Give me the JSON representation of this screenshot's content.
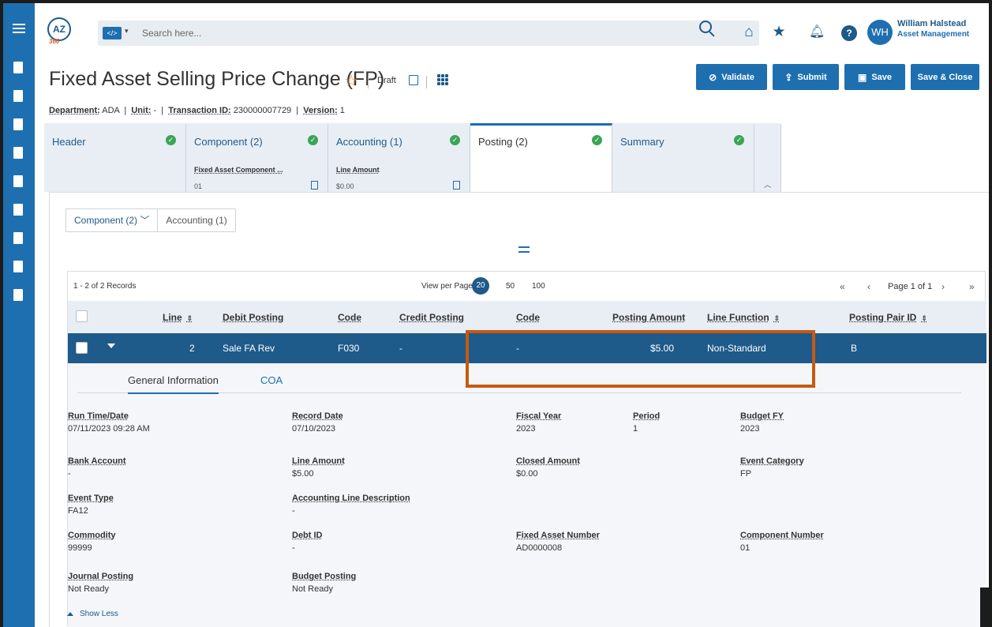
{
  "user": {
    "initials": "WH",
    "name": "William Halstead",
    "role": "Asset Management"
  },
  "logo": {
    "text": "AZ",
    "sub": "360"
  },
  "search": {
    "placeholder": "Search here...",
    "scope_icon": "code-icon"
  },
  "page": {
    "title": "Fixed Asset Selling Price Change (FP)",
    "status": "Draft",
    "department_label": "Department:",
    "department": "ADA",
    "unit_label": "Unit:",
    "unit": "-",
    "transaction_label": "Transaction ID:",
    "transaction_id": "230000007729",
    "version_label": "Version:",
    "version": "1"
  },
  "actions": {
    "validate": "Validate",
    "submit": "Submit",
    "save": "Save",
    "save_close": "Save & Close"
  },
  "tabs": [
    {
      "label": "Header"
    },
    {
      "label": "Component (2)",
      "sub_label": "Fixed Asset Component ...",
      "sub_value": "01"
    },
    {
      "label": "Accounting (1)",
      "sub_label": "Line Amount",
      "sub_value": "$0.00"
    },
    {
      "label": "Posting (2)"
    },
    {
      "label": "Summary"
    }
  ],
  "breadcrumb": [
    "Component (2)",
    "Accounting (1)"
  ],
  "grid": {
    "records": "1 - 2 of 2 Records",
    "view_per_page": "View per Page -",
    "page_sizes": [
      "20",
      "50",
      "100"
    ],
    "page_info": "Page 1 of 1",
    "columns": [
      "Line",
      "Debit Posting",
      "Code",
      "Credit Posting",
      "Code",
      "Posting Amount",
      "Line Function",
      "Posting Pair ID"
    ],
    "row": {
      "line": "2",
      "debit_posting": "Sale FA Rev",
      "debit_code": "F030",
      "credit_posting": "-",
      "credit_code": "-",
      "posting_amount": "$5.00",
      "line_function": "Non-Standard",
      "posting_pair_id": "B"
    }
  },
  "detail": {
    "tabs": [
      "General Information",
      "COA"
    ],
    "fields": {
      "run_time": {
        "label": "Run Time/Date",
        "value": "07/11/2023 09:28 AM"
      },
      "record_date": {
        "label": "Record Date",
        "value": "07/10/2023"
      },
      "fiscal_year": {
        "label": "Fiscal Year",
        "value": "2023"
      },
      "period": {
        "label": "Period",
        "value": "1"
      },
      "budget_fy": {
        "label": "Budget FY",
        "value": "2023"
      },
      "bank_account": {
        "label": "Bank Account",
        "value": "-"
      },
      "line_amount": {
        "label": "Line Amount",
        "value": "$5.00"
      },
      "closed_amount": {
        "label": "Closed Amount",
        "value": "$0.00"
      },
      "event_category": {
        "label": "Event Category",
        "value": "FP"
      },
      "event_type": {
        "label": "Event Type",
        "value": "FA12"
      },
      "acct_line_desc": {
        "label": "Accounting Line Description",
        "value": "-"
      },
      "commodity": {
        "label": "Commodity",
        "value": "99999"
      },
      "debt_id": {
        "label": "Debt ID",
        "value": "-"
      },
      "fixed_asset_number": {
        "label": "Fixed Asset Number",
        "value": "AD0000008"
      },
      "component_number": {
        "label": "Component Number",
        "value": "01"
      },
      "journal_posting": {
        "label": "Journal Posting",
        "value": "Not Ready"
      },
      "budget_posting": {
        "label": "Budget Posting",
        "value": "Not Ready"
      }
    },
    "show_less": "Show Less"
  },
  "colors": {
    "primary": "#1e6fb0",
    "dark": "#1e5a8a",
    "highlight": "#c55a11",
    "check": "#3aa655"
  }
}
